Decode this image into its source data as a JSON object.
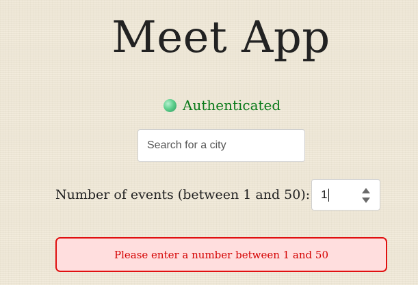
{
  "header": {
    "title": "Meet App"
  },
  "auth": {
    "status_text": "Authenticated",
    "status_color": "#0a7a1a",
    "indicator_icon": "green-status-dot"
  },
  "search": {
    "placeholder": "Search for a city",
    "value": ""
  },
  "events": {
    "label": "Number of events (between 1 and 50):",
    "value": "1",
    "spinner_icons": [
      "chevron-up-icon",
      "chevron-down-icon"
    ]
  },
  "alert": {
    "message": "Please enter a number between 1 and 50",
    "border_color": "#e01010",
    "background_color": "#ffdede",
    "text_color": "#d40000"
  },
  "page": {
    "background_color": "#efe8d6"
  }
}
